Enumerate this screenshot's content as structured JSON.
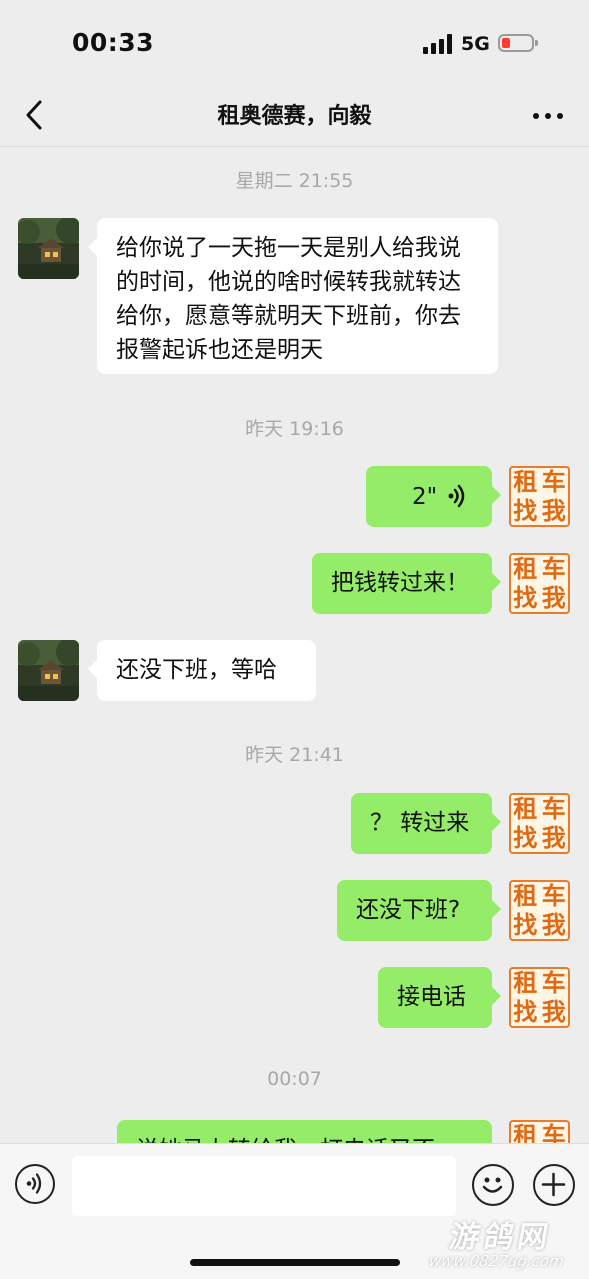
{
  "status_bar": {
    "time": "00:33",
    "network": "5G"
  },
  "header": {
    "title": "租奥德赛，向毅"
  },
  "timestamps": [
    "星期二 21:55",
    "昨天 19:16",
    "昨天 21:41",
    "00:07"
  ],
  "messages": [
    {
      "side": "in",
      "text": "给你说了一天拖一天是别人给我说的时间，他说的啥时候转我就转达给你，愿意等就明天下班前，你去报警起诉也还是明天"
    },
    {
      "side": "out",
      "type": "voice",
      "duration": "2\""
    },
    {
      "side": "out",
      "text": "把钱转过来！"
    },
    {
      "side": "in",
      "text": "还没下班，等哈"
    },
    {
      "side": "out",
      "text": "？ 转过来"
    },
    {
      "side": "out",
      "text": "还没下班?"
    },
    {
      "side": "out",
      "text": "接电话"
    },
    {
      "side": "out",
      "text": "说她马上转给我，打电话又不"
    }
  ],
  "my_avatar": {
    "chars": [
      "租",
      "车",
      "找",
      "我"
    ]
  },
  "watermark": {
    "line1": "游鸽网",
    "line2": "www.0827ug.com"
  },
  "colors": {
    "out_bubble": "#95ec69",
    "in_bubble": "#ffffff",
    "background": "#ededed"
  }
}
